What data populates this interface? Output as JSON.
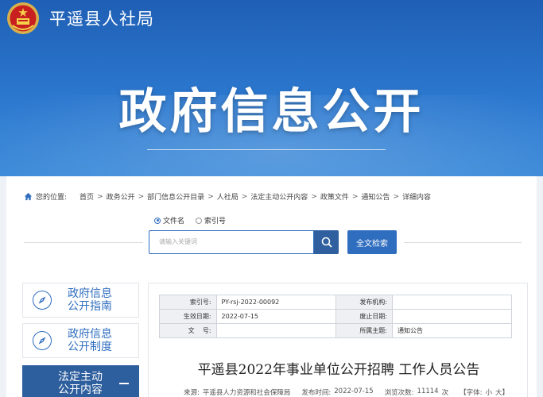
{
  "header": {
    "site_name": "平遥县人社局",
    "big_title": "政府信息公开"
  },
  "breadcrumb": {
    "prefix": "您的位置:",
    "items": [
      "首页",
      "政务公开",
      "部门信息公开目录",
      "人社局",
      "法定主动公开内容",
      "政策文件",
      "通知公告",
      "详细内容"
    ],
    "separator": ">"
  },
  "search": {
    "radio_options": [
      {
        "label": "文件名",
        "selected": true
      },
      {
        "label": "索引号",
        "selected": false
      }
    ],
    "placeholder": "请输入关键词",
    "fulltext_label": "全文检索"
  },
  "sidebar": {
    "items": [
      {
        "line1": "政府信息",
        "line2": "公开指南",
        "active": false,
        "icon": "compass-icon"
      },
      {
        "line1": "政府信息",
        "line2": "公开制度",
        "active": false,
        "icon": "compass-icon"
      },
      {
        "line1": "法定主动",
        "line2": "公开内容",
        "active": true,
        "icon": "minus-icon"
      }
    ]
  },
  "meta_table": {
    "rows": [
      {
        "k1": "索引号:",
        "v1": "PY-rsj-2022-00092",
        "k2": "发布机构:",
        "v2": ""
      },
      {
        "k1": "生效日期:",
        "v1": "2022-07-15",
        "k2": "废止日期:",
        "v2": ""
      },
      {
        "k1": "文    号:",
        "v1": "",
        "k2": "所属主题:",
        "v2": "通知公告"
      }
    ]
  },
  "article": {
    "title": "平遥县2022年事业单位公开招聘 工作人员公告",
    "source_label": "来源:",
    "source": "平遥县人力资源和社会保障局",
    "publish_label": "发布时间:",
    "publish_time": "2022-07-15",
    "views_label": "浏览次数:",
    "views": "11114",
    "views_unit": "次",
    "font_label": "【字体:",
    "font_small": "小",
    "font_large": "大】"
  },
  "colors": {
    "banner": "#2c78cf",
    "accent": "#2f6dbf",
    "sidebar_active": "#2d5e9d"
  }
}
